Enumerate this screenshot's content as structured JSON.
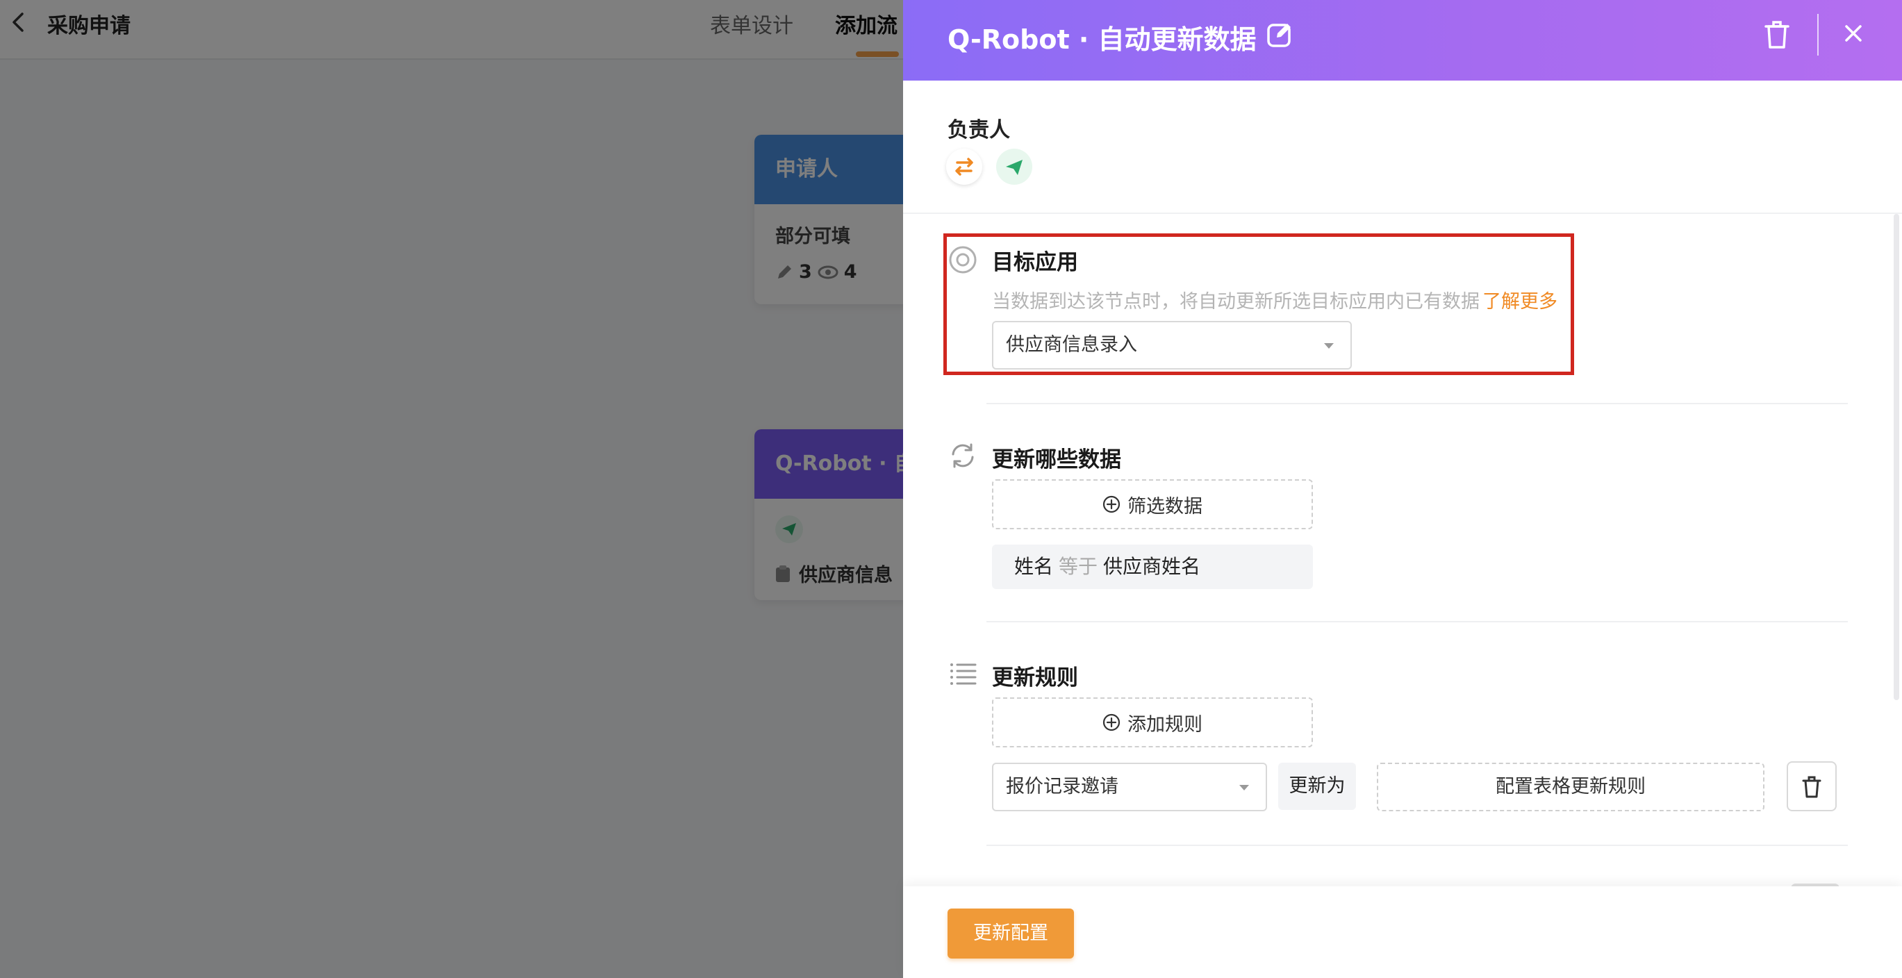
{
  "app": {
    "title": "采购申请"
  },
  "top_tabs": [
    {
      "label": "表单设计"
    },
    {
      "label": "添加流"
    }
  ],
  "background_nodes": {
    "applicant_card": {
      "title": "申请人",
      "sub": "部分可填",
      "edit_count": "3",
      "view_count": "4"
    },
    "robot_card": {
      "title": "Q-Robot · 自",
      "field": "供应商信息"
    }
  },
  "drawer": {
    "title": "Q-Robot · 自动更新数据",
    "owner": {
      "label": "负责人"
    },
    "target_app": {
      "title": "目标应用",
      "description": "当数据到达该节点时，将自动更新所选目标应用内已有数据",
      "learn_more": "了解更多",
      "selected": "供应商信息录入"
    },
    "which_data": {
      "title": "更新哪些数据",
      "filter_button": "筛选数据",
      "condition": {
        "field": "姓名",
        "operator": "等于",
        "value": "供应商姓名"
      }
    },
    "rules": {
      "title": "更新规则",
      "add_button": "添加规则",
      "rule_field": "报价记录邀请",
      "update_as": "更新为",
      "config_button": "配置表格更新规则"
    },
    "footer": {
      "submit_label": "更新配置"
    }
  },
  "colors": {
    "header_gradient_start": "#8b6cf6",
    "header_gradient_end": "#b46ef0",
    "accent_orange": "#f09a38",
    "link_orange": "#f08a24",
    "highlight_red": "#d0271f"
  }
}
